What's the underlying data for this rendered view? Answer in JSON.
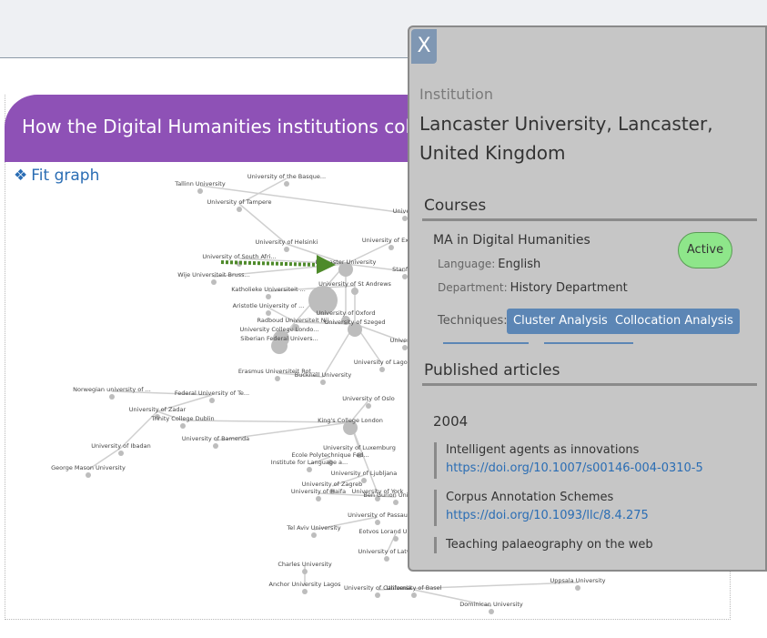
{
  "page": {
    "title": "How the Digital Humanities institutions coll",
    "fit_graph_label": "Fit graph",
    "fit_graph_icon": "diamond-icon"
  },
  "graph": {
    "nodes": [
      {
        "label": "Tallinn University"
      },
      {
        "label": "University of the Basque..."
      },
      {
        "label": "University of Tampere"
      },
      {
        "label": "Universi"
      },
      {
        "label": "University of Helsinki"
      },
      {
        "label": "University of Exeter"
      },
      {
        "label": "University of South Afri..."
      },
      {
        "label": "Lancaster University"
      },
      {
        "label": "Stanford"
      },
      {
        "label": "Wije Universiteit Bruss..."
      },
      {
        "label": "Katholieke Universiteit ..."
      },
      {
        "label": "University of St Andrews"
      },
      {
        "label": "Aristotle University of ..."
      },
      {
        "label": "University of Oxford"
      },
      {
        "label": "Radboud Universiteit Nij..."
      },
      {
        "label": "University of Szeged"
      },
      {
        "label": "University College Londo..."
      },
      {
        "label": "University"
      },
      {
        "label": "Siberian Federal Univers..."
      },
      {
        "label": "University of Lagos"
      },
      {
        "label": "Erasmus Universiteit Rot..."
      },
      {
        "label": "Bucknell University"
      },
      {
        "label": "Norwegian university of ..."
      },
      {
        "label": "Federal University of Te..."
      },
      {
        "label": "University of Oslo"
      },
      {
        "label": "University of Zadar"
      },
      {
        "label": "Trinity College Dublin"
      },
      {
        "label": "King's College London"
      },
      {
        "label": "University of Bamenda"
      },
      {
        "label": "University of Ibadan"
      },
      {
        "label": "University of Luxemburg"
      },
      {
        "label": "George Mason University"
      },
      {
        "label": "Ecole Polytechnique Fed..."
      },
      {
        "label": "Institute for Language a..."
      },
      {
        "label": "University of Ljubljana"
      },
      {
        "label": "University of Zagreb"
      },
      {
        "label": "University of York"
      },
      {
        "label": "University of Haifa"
      },
      {
        "label": "Ben Gurion University"
      },
      {
        "label": "University of Passau"
      },
      {
        "label": "Tel Aviv University"
      },
      {
        "label": "Eotvos Lorand University"
      },
      {
        "label": "University of Latvia"
      },
      {
        "label": "Charles University"
      },
      {
        "label": "Anchor University Lagos"
      },
      {
        "label": "University of California"
      },
      {
        "label": "Uppsala University"
      },
      {
        "label": "University of Basel"
      },
      {
        "label": "Dominican University"
      }
    ]
  },
  "panel": {
    "close_label": "X",
    "institution_label": "Institution",
    "institution_name": "Lancaster University, Lancaster, United Kingdom",
    "courses_heading": "Courses",
    "course": {
      "title": "MA in Digital Humanities",
      "status": "Active",
      "status_color": "#8ee68a",
      "language_label": "Language:",
      "language": "English",
      "department_label": "Department:",
      "department": "History Department",
      "techniques_label": "Techniques:",
      "techniques": [
        "Cluster Analysis",
        "Collocation Analysis"
      ]
    },
    "articles_heading": "Published articles",
    "year": "2004",
    "articles": [
      {
        "title": "Intelligent agents as innovations",
        "link": "https://doi.org/10.1007/s00146-004-0310-5"
      },
      {
        "title": "Corpus Annotation Schemes",
        "link": "https://doi.org/10.1093/llc/8.4.275"
      },
      {
        "title": "Teaching palaeography on the web",
        "link": ""
      }
    ]
  },
  "colors": {
    "header": "#8e51b6",
    "link": "#2a6db4",
    "tag": "#5c86b5",
    "active": "#8ee68a",
    "arrow": "#4e8a2a"
  }
}
